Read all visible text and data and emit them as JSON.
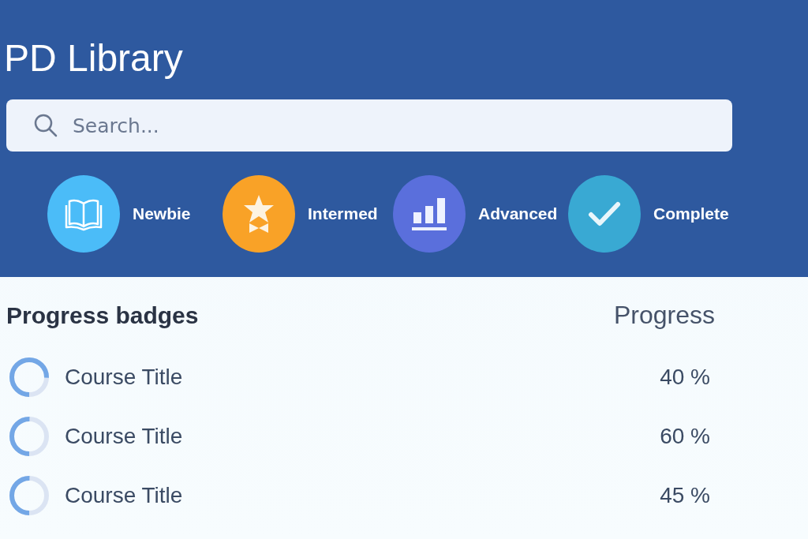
{
  "header": {
    "title": "PD Library",
    "search": {
      "placeholder": "Search..."
    }
  },
  "badges": [
    {
      "kind": "book",
      "label": "Newbie",
      "color": "#4bbcf8"
    },
    {
      "kind": "star",
      "label": "Intermed",
      "color": "#f9a227"
    },
    {
      "kind": "chart",
      "label": "Advanced",
      "color": "#5a6fdc"
    },
    {
      "kind": "check",
      "label": "Complete",
      "color": "#39a9d3"
    }
  ],
  "progress": {
    "title": "Progress badges",
    "column": "Progress",
    "rows": [
      {
        "title": "Course Title",
        "level": 0.75,
        "reading": "40 %"
      },
      {
        "title": "Course Title",
        "level": 0.5,
        "reading": "60 %"
      },
      {
        "title": "Course Title",
        "level": 0.5,
        "reading": "45 %"
      }
    ]
  }
}
